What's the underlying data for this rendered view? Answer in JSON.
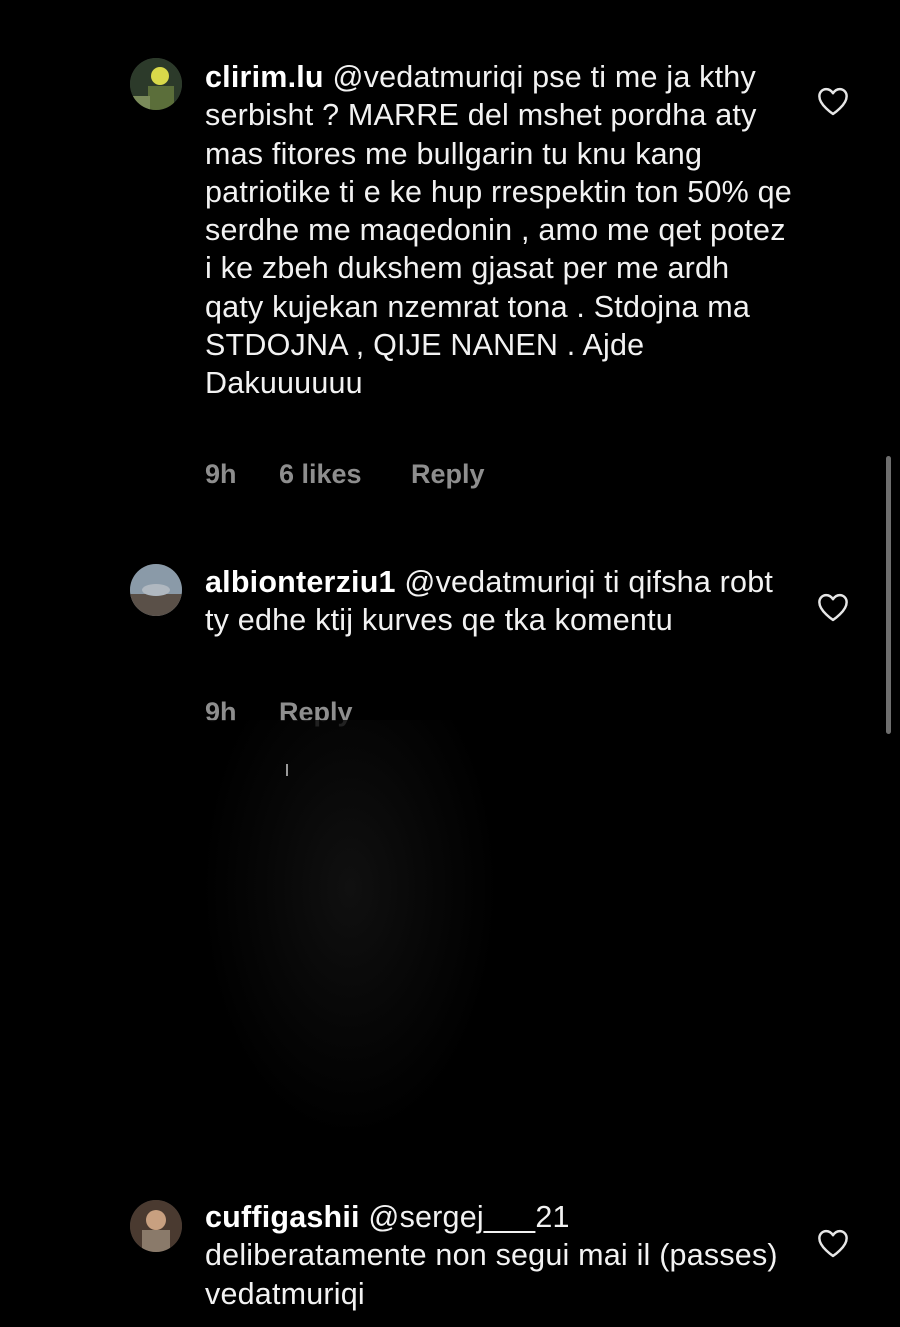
{
  "comments": [
    {
      "username": "clirim.lu",
      "text": "@vedatmuriqi pse ti me ja kthy serbisht ? MARRE del mshet pordha aty mas fitores me bullgarin tu knu kang patriotike ti e ke hup rrespektin ton 50% qe serdhe me maqedonin , amo me qet potez i ke zbeh dukshem gjasat per me ardh qaty kujekan nzemrat tona . Stdojna ma STDOJNA , QIJE NANEN . Ajde Dakuuuuuu",
      "time": "9h",
      "likes": "6 likes",
      "reply": "Reply"
    },
    {
      "username": "albionterziu1",
      "text": "@vedatmuriqi ti qifsha robt ty edhe ktij kurves qe tka komentu",
      "time": "9h",
      "reply": "Reply"
    },
    {
      "username": "cuffigashii",
      "text": "@sergej___21 deliberatamente non segui mai il (passes) vedatmuriqi"
    }
  ],
  "colors": {
    "background": "#000000",
    "text": "#f2f2f2",
    "meta": "#8e8e8e"
  },
  "icons": [
    "heart-outline-icon",
    "avatar"
  ]
}
